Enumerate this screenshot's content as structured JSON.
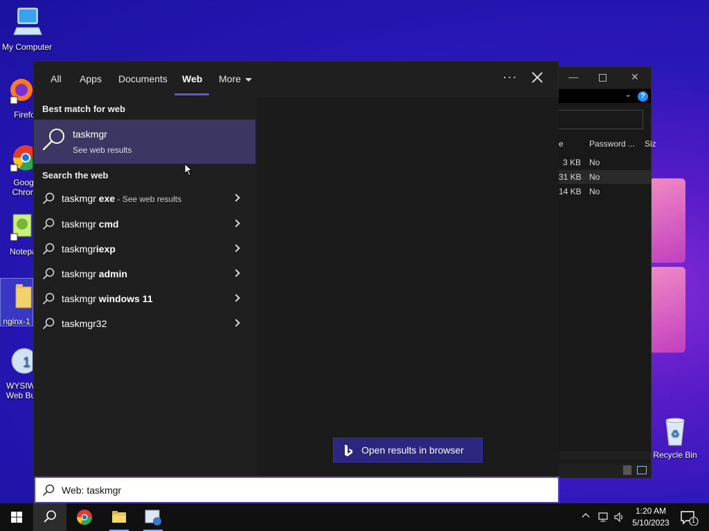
{
  "desktop": {
    "icons": [
      {
        "label": "My Computer"
      },
      {
        "label": "Firefo"
      },
      {
        "label": "Goog Chron"
      },
      {
        "label": "Notepa"
      },
      {
        "label": "nginx-1"
      },
      {
        "label": "WYSIW Web Bu"
      },
      {
        "label": "Recycle Bin"
      }
    ]
  },
  "explorer": {
    "columns": [
      "e",
      "Password ...",
      "Siz"
    ],
    "rows": [
      {
        "size": "3 KB",
        "password": "No"
      },
      {
        "size": "31 KB",
        "password": "No"
      },
      {
        "size": "14 KB",
        "password": "No"
      }
    ],
    "help": "?"
  },
  "search": {
    "tabs": [
      {
        "label": "All"
      },
      {
        "label": "Apps"
      },
      {
        "label": "Documents"
      },
      {
        "label": "Web"
      },
      {
        "label": "More"
      }
    ],
    "active_tab": "Web",
    "more_options": "···",
    "best_match_heading": "Best match for web",
    "best_match": {
      "title": "taskmgr",
      "subtitle": "See web results"
    },
    "search_web_heading": "Search the web",
    "results": [
      {
        "prefix": "taskmgr",
        "bold": " exe",
        "suffix": " - See web results"
      },
      {
        "prefix": "taskmgr",
        "bold": " cmd",
        "suffix": ""
      },
      {
        "prefix": "taskmgr",
        "bold": "iexp",
        "suffix": ""
      },
      {
        "prefix": "taskmgr",
        "bold": " admin",
        "suffix": ""
      },
      {
        "prefix": "taskmgr",
        "bold": " windows 11",
        "suffix": ""
      },
      {
        "prefix": "taskmgr32",
        "bold": "",
        "suffix": ""
      }
    ],
    "open_browser_label": "Open results in browser",
    "query": "Web: taskmgr"
  },
  "taskbar": {
    "time": "1:20 AM",
    "date": "5/10/2023",
    "notification_count": "1"
  },
  "colors": {
    "accent": "#5a5ae0",
    "selected_row": "#3c3662",
    "open_browser_bg": "#2b267e",
    "search_border": "#4b3bd0"
  }
}
